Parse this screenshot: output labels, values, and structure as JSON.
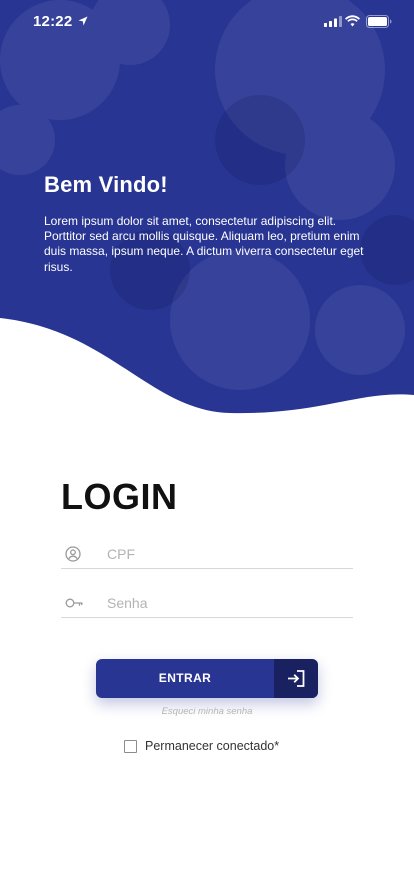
{
  "status_bar": {
    "time": "12:22",
    "icons": [
      "location-arrow-icon",
      "cellular-signal-icon",
      "wifi-icon",
      "battery-icon"
    ]
  },
  "hero": {
    "title": "Bem Vindo!",
    "text": "Lorem ipsum dolor sit amet, consectetur adipiscing elit. Porttitor sed arcu mollis quisque. Aliquam leo, pretium enim duis massa, ipsum neque. A dictum viverra consectetur eget risus.",
    "background_color": "#283593"
  },
  "login": {
    "title": "LOGIN",
    "cpf_placeholder": "CPF",
    "senha_placeholder": "Senha",
    "cpf_icon": "user-circle-icon",
    "senha_icon": "key-icon",
    "enter_label": "ENTRAR",
    "enter_icon": "sign-in-icon",
    "forgot_label": "Esqueci minha senha",
    "remember_label": "Permanecer conectado*",
    "remember_checked": false
  },
  "colors": {
    "primary": "#283593",
    "primary_dark": "#1a2161"
  }
}
